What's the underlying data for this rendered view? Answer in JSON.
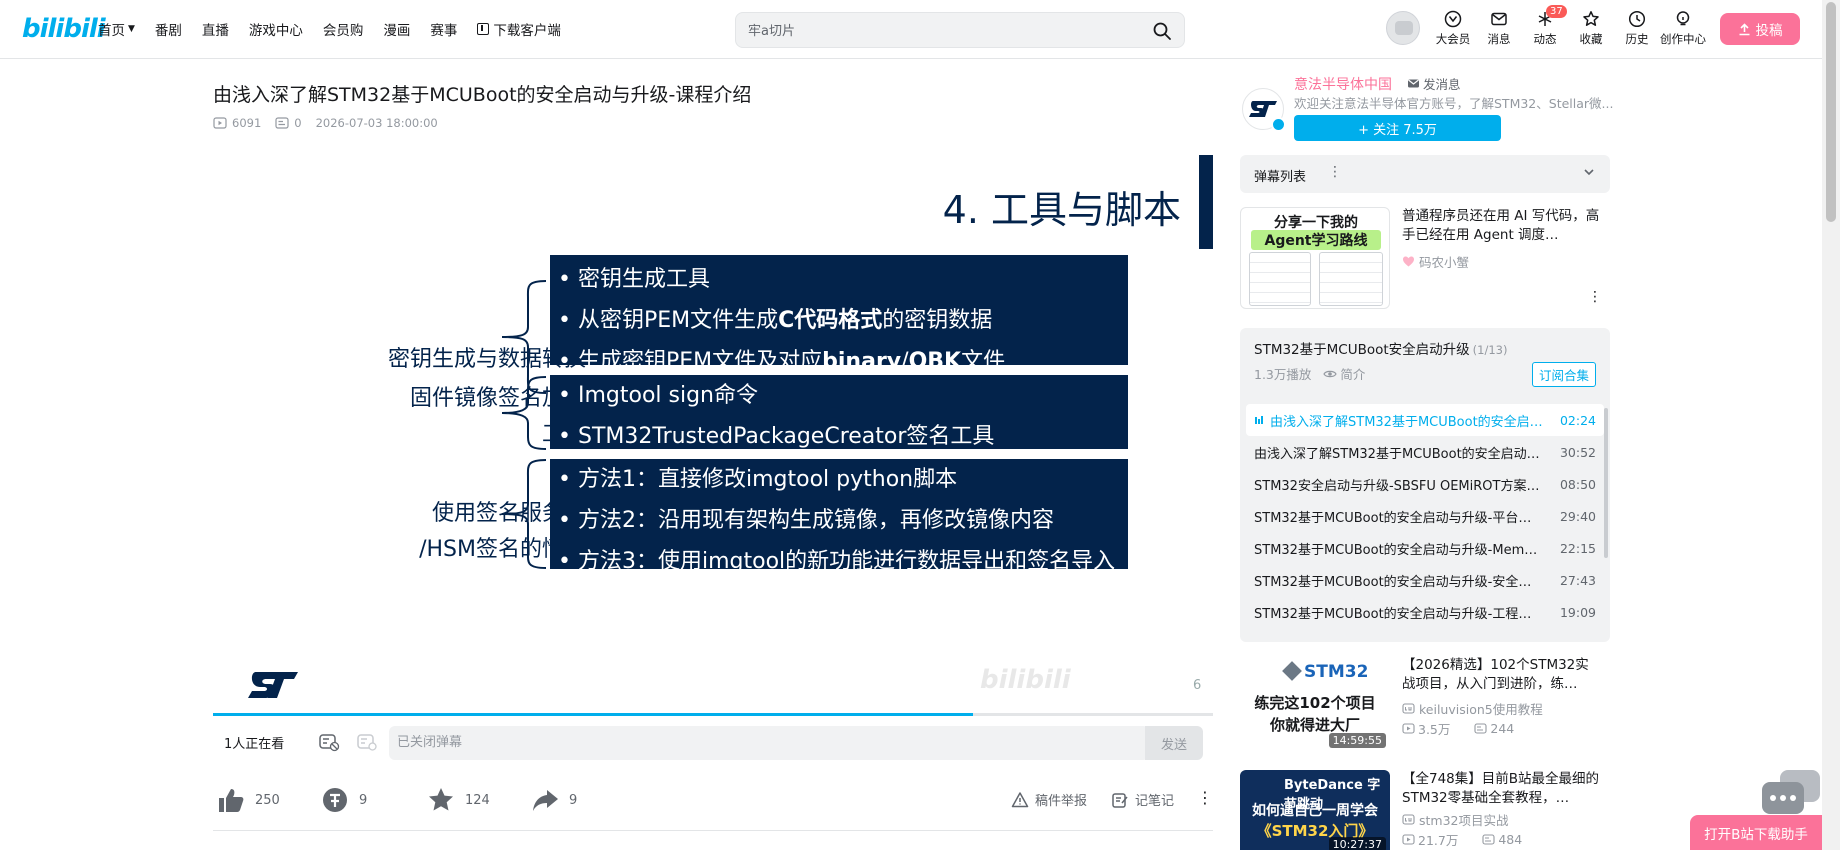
{
  "header": {
    "logo": "bilibili",
    "nav": [
      {
        "label": "首页",
        "chevron": true
      },
      {
        "label": "番剧"
      },
      {
        "label": "直播"
      },
      {
        "label": "游戏中心"
      },
      {
        "label": "会员购"
      },
      {
        "label": "漫画"
      },
      {
        "label": "赛事"
      },
      {
        "label": "下载客户端",
        "icon": "download-icon"
      }
    ],
    "search_placeholder": "牢a切片",
    "right_nav": [
      {
        "label": "大会员",
        "icon": "vip-icon"
      },
      {
        "label": "消息",
        "icon": "message-icon"
      },
      {
        "label": "动态",
        "icon": "dynamic-icon",
        "badge": "37"
      },
      {
        "label": "收藏",
        "icon": "star-icon"
      },
      {
        "label": "历史",
        "icon": "clock-icon"
      },
      {
        "label": "创作中心",
        "icon": "bulb-icon"
      }
    ],
    "upload_label": "投稿"
  },
  "video": {
    "title": "由浅入深了解STM32基于MCUBoot的安全启动与升级-课程介绍",
    "views": "6091",
    "danmaku": "0",
    "date": "2026-07-03 18:00:00",
    "progress": 0.76
  },
  "slide": {
    "title": "4. 工具与脚本",
    "rows": [
      {
        "label": [
          "密钥生成与数据转换"
        ],
        "bullets": [
          [
            {
              "t": "密钥生成工具"
            }
          ],
          [
            {
              "t": "从密钥PEM文件生成"
            },
            {
              "t": "C代码格式",
              "b": true
            },
            {
              "t": "的密钥数据"
            }
          ],
          [
            {
              "t": "生成密钥PEM文件及对应"
            },
            {
              "t": "binary",
              "b": true
            },
            {
              "t": "/"
            },
            {
              "t": "OBK",
              "b": true
            },
            {
              "t": "文件"
            }
          ]
        ]
      },
      {
        "label": [
          "固件镜像签名加密",
          "工具"
        ],
        "bullets": [
          [
            {
              "t": "Imgtool sign命令"
            }
          ],
          [
            {
              "t": "STM32TrustedPackageCreator签名工具"
            }
          ]
        ]
      },
      {
        "label": [
          "使用签名服务器",
          "/HSM签名的情况"
        ],
        "bullets": [
          [
            {
              "t": "方法1：直接修改imgtool python脚本"
            }
          ],
          [
            {
              "t": "方法2：沿用现有架构生成镜像，再修改镜像内容"
            }
          ],
          [
            {
              "t": "方法3：使用imgtool的新功能进行数据导出和签名导入"
            }
          ]
        ]
      }
    ],
    "page_number": "6",
    "watermark": "bilibili",
    "colors": {
      "navy": "#03234b",
      "accent": "#00aeec",
      "pink": "#fb7299"
    }
  },
  "danmaku_bar": {
    "watching": "1人正在看",
    "input_placeholder": "已关闭弹幕",
    "send_label": "发送"
  },
  "toolbar": {
    "like": "250",
    "coin": "9",
    "favorite": "124",
    "share": "9",
    "report": "稿件举报",
    "notes": "记笔记"
  },
  "uploader": {
    "name": "意法半导体中国",
    "message": "发消息",
    "desc": "欢迎关注意法半导体官方账号，了解STM32、Stellar微...",
    "follow": "+ 关注 7.5万"
  },
  "danmaku_list": {
    "label": "弹幕列表"
  },
  "rec_top": {
    "thumb_line1": "分享一下我的",
    "thumb_line2": "Agent学习路线",
    "title": "普通程序员还在用 AI 写代码，高手已经在用 Agent 调度…",
    "author": "码农小蟹"
  },
  "playlist": {
    "title": "STM32基于MCUBoot安全启动升级",
    "count": "(1/13)",
    "plays": "1.3万播放",
    "intro": "简介",
    "subscribe": "订阅合集",
    "items": [
      {
        "title": "由浅入深了解STM32基于MCUBoot的安全启…",
        "duration": "02:24",
        "active": true
      },
      {
        "title": "由浅入深了解STM32基于MCUBoot的安全启动…",
        "duration": "30:52"
      },
      {
        "title": "STM32安全启动与升级-SBSFU OEMiROT方案…",
        "duration": "08:50"
      },
      {
        "title": "STM32基于MCUBoot的安全启动与升级-平台初…",
        "duration": "29:40"
      },
      {
        "title": "STM32基于MCUBoot的安全启动与升级-Memor…",
        "duration": "22:15"
      },
      {
        "title": "STM32基于MCUBoot的安全启动与升级-安全启…",
        "duration": "27:43"
      },
      {
        "title": "STM32基于MCUBoot的安全启动与升级-工程的…",
        "duration": "19:09"
      }
    ]
  },
  "rec1": {
    "thumb_brand": "STM32",
    "thumb_line1": "练完这102个项目",
    "thumb_line2": "你就得进大厂",
    "duration": "14:59:55",
    "title": "【2026精选】102个STM32实战项目，从入门到进阶，练…",
    "author": "keiluvision5使用教程",
    "views": "3.5万",
    "danmaku": "244"
  },
  "rec2": {
    "thumb_brand": "ByteDance 字节跳动",
    "thumb_line1": "如何逼自己一周学会",
    "thumb_line2": "《STM32入门》",
    "duration": "10:27:37",
    "title": "【全748集】目前B站最全最细的STM32零基础全套教程，…",
    "author": "stm32项目实战",
    "views": "21.7万",
    "danmaku": "484"
  },
  "floating": {
    "open_app": "打开B站下载助手"
  }
}
